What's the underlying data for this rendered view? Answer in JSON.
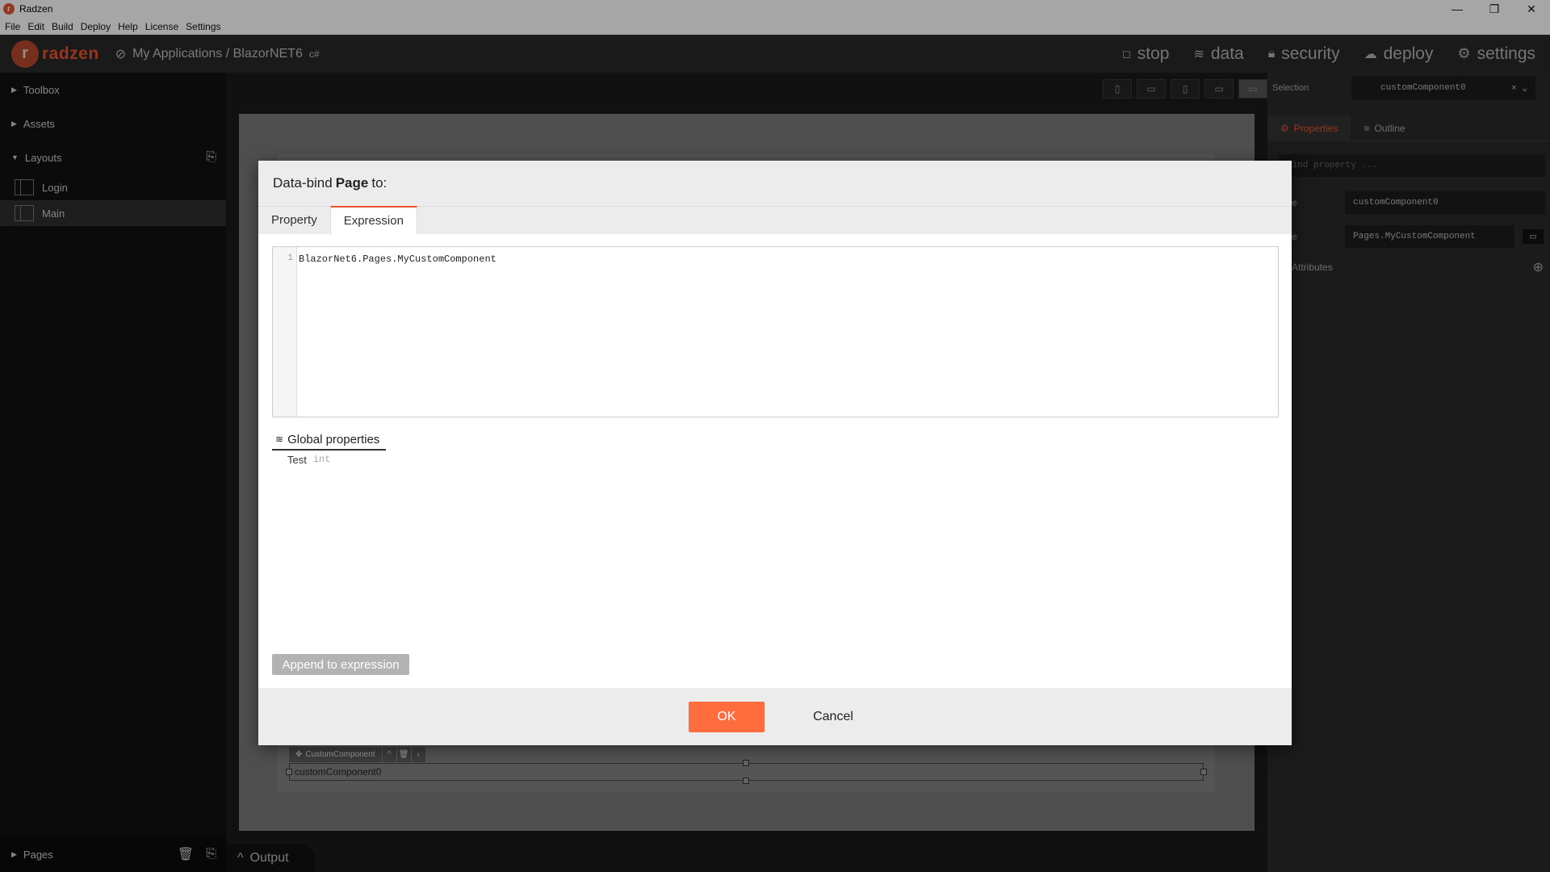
{
  "window": {
    "title": "Radzen",
    "minimize": "—",
    "maximize": "❐",
    "close": "✕"
  },
  "menu": [
    "File",
    "Edit",
    "Build",
    "Deploy",
    "Help",
    "License",
    "Settings"
  ],
  "topnav": {
    "logo_text": "radzen",
    "breadcrumb": "My Applications / BlazorNET6",
    "breadcrumb_suffix": "c#",
    "items": {
      "stop": "stop",
      "data": "data",
      "security": "security",
      "deploy": "deploy",
      "settings": "settings"
    }
  },
  "left_panel": {
    "toolbox": "Toolbox",
    "assets": "Assets",
    "layouts": "Layouts",
    "layout_items": [
      "Login",
      "Main"
    ],
    "pages": "Pages"
  },
  "canvas": {
    "component_label": "CustomComponent",
    "component_text": "customComponent0"
  },
  "output_tab": "Output",
  "right_panel": {
    "selection_label": "Selection",
    "selection_value": "customComponent0",
    "tabs": {
      "properties": "Properties",
      "outline": "Outline"
    },
    "find_placeholder": "Find property ...",
    "name_label": "e",
    "name_value": "customComponent0",
    "type_label": "e",
    "type_value": "Pages.MyCustomComponent",
    "attributes_label": "Attributes"
  },
  "dialog": {
    "title_prefix": "Data-bind",
    "title_bold": "Page",
    "title_suffix": "to:",
    "tabs": [
      "Property",
      "Expression"
    ],
    "active_tab": "Expression",
    "line_number": "1",
    "expression": "BlazorNet6.Pages.MyCustomComponent",
    "global_properties_title": "Global properties",
    "global_properties": [
      {
        "name": "Test",
        "type": "int"
      }
    ],
    "append_button": "Append to expression",
    "ok_button": "OK",
    "cancel_button": "Cancel"
  },
  "colors": {
    "accent": "#ff6d3f",
    "brand": "#e8542f"
  }
}
